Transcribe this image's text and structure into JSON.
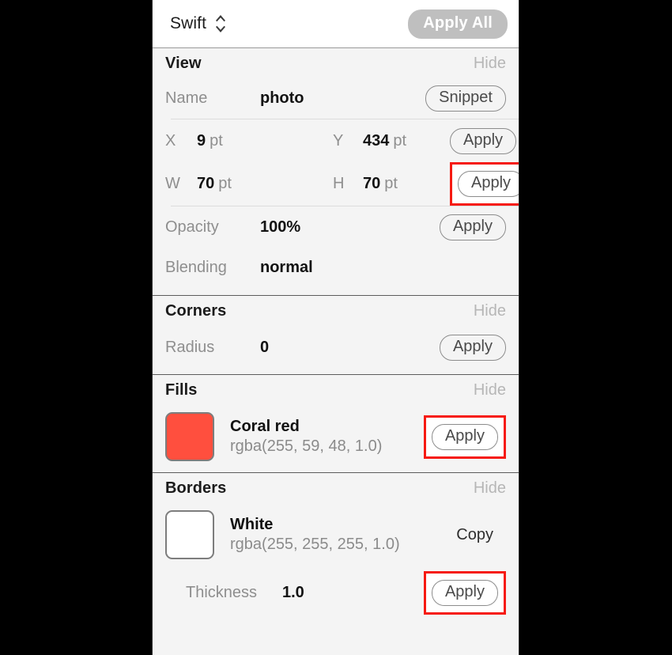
{
  "topbar": {
    "language": "Swift",
    "stepper_icon": "chevron-up-down-icon",
    "apply_all_label": "Apply All"
  },
  "sections": {
    "view": {
      "title": "View",
      "hide_label": "Hide",
      "name_label": "Name",
      "name_value": "photo",
      "snippet_label": "Snippet",
      "x_label": "X",
      "x_value": "9",
      "x_unit": "pt",
      "y_label": "Y",
      "y_value": "434",
      "y_unit": "pt",
      "xy_apply_label": "Apply",
      "w_label": "W",
      "w_value": "70",
      "w_unit": "pt",
      "h_label": "H",
      "h_value": "70",
      "h_unit": "pt",
      "wh_apply_label": "Apply",
      "opacity_label": "Opacity",
      "opacity_value": "100%",
      "opacity_apply_label": "Apply",
      "blending_label": "Blending",
      "blending_value": "normal"
    },
    "corners": {
      "title": "Corners",
      "hide_label": "Hide",
      "radius_label": "Radius",
      "radius_value": "0",
      "radius_apply_label": "Apply"
    },
    "fills": {
      "title": "Fills",
      "hide_label": "Hide",
      "color_name": "Coral red",
      "color_rgba": "rgba(255, 59, 48, 1.0)",
      "color_hex": "#ff4f3e",
      "apply_label": "Apply"
    },
    "borders": {
      "title": "Borders",
      "hide_label": "Hide",
      "color_name": "White",
      "color_rgba": "rgba(255, 255, 255, 1.0)",
      "color_hex": "#ffffff",
      "copy_label": "Copy",
      "thickness_label": "Thickness",
      "thickness_value": "1.0",
      "apply_label": "Apply"
    }
  },
  "highlight": {
    "color": "#f61a12"
  }
}
